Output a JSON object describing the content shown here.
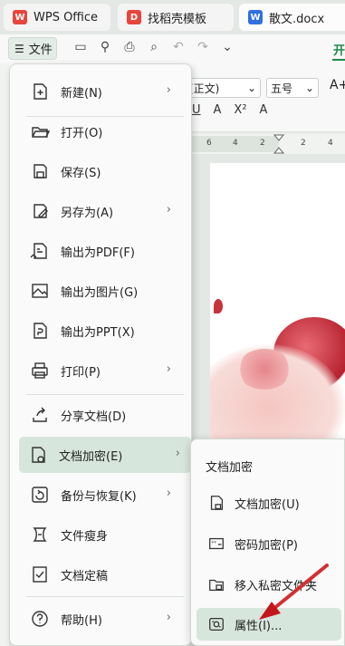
{
  "tabs": [
    {
      "label": "WPS Office",
      "icon": "wps-logo-icon"
    },
    {
      "label": "找稻壳模板",
      "icon": "daoke-logo-icon"
    },
    {
      "label": "散文.docx",
      "icon": "word-doc-icon"
    }
  ],
  "toolbar": {
    "file_label": "文件",
    "start_tab": "开"
  },
  "ribbon": {
    "font_name": "(正文)",
    "font_size": "五号",
    "grow_font": "A+",
    "format_items": [
      "U",
      "A",
      "X²",
      "A"
    ]
  },
  "ruler": {
    "marks": [
      "6",
      "4",
      "2",
      "2",
      "4"
    ]
  },
  "menu": {
    "items": [
      {
        "label": "新建(N)",
        "icon": "new-doc-icon",
        "arrow": true
      },
      {
        "label": "打开(O)",
        "icon": "folder-open-icon",
        "arrow": false
      },
      {
        "label": "保存(S)",
        "icon": "save-icon",
        "arrow": false
      },
      {
        "label": "另存为(A)",
        "icon": "save-as-icon",
        "arrow": true
      },
      {
        "label": "输出为PDF(F)",
        "icon": "export-pdf-icon",
        "arrow": false
      },
      {
        "label": "输出为图片(G)",
        "icon": "export-image-icon",
        "arrow": false
      },
      {
        "label": "输出为PPT(X)",
        "icon": "export-ppt-icon",
        "arrow": false
      },
      {
        "label": "打印(P)",
        "icon": "print-icon",
        "arrow": true
      },
      {
        "label": "分享文档(D)",
        "icon": "share-icon",
        "arrow": false
      },
      {
        "label": "文档加密(E)",
        "icon": "doc-encrypt-icon",
        "arrow": true
      },
      {
        "label": "备份与恢复(K)",
        "icon": "backup-icon",
        "arrow": true
      },
      {
        "label": "文件瘦身",
        "icon": "slim-file-icon",
        "arrow": false
      },
      {
        "label": "文档定稿",
        "icon": "finalize-icon",
        "arrow": false
      },
      {
        "label": "帮助(H)",
        "icon": "help-icon",
        "arrow": true
      }
    ]
  },
  "submenu": {
    "title": "文档加密",
    "items": [
      {
        "label": "文档加密(U)",
        "icon": "doc-lock-icon"
      },
      {
        "label": "密码加密(P)",
        "icon": "password-icon"
      },
      {
        "label": "移入私密文件夹",
        "icon": "private-folder-icon"
      },
      {
        "label": "属性(I)...",
        "icon": "properties-icon"
      }
    ]
  },
  "colors": {
    "accent": "#1f8a4c",
    "active_bg": "#d7e6dc",
    "arrow": "#d82a2a"
  }
}
